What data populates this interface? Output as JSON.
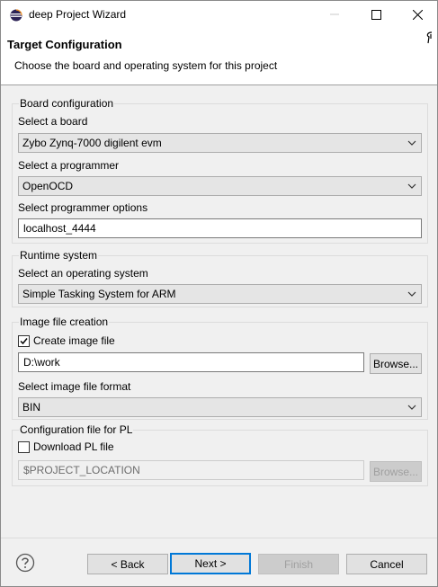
{
  "window": {
    "title": "deep Project Wizard"
  },
  "banner": {
    "title": "Target Configuration",
    "description": "Choose the board and operating system for this project"
  },
  "board_group": {
    "title": "Board configuration",
    "board_label": "Select a board",
    "board_value": "Zybo Zynq-7000 digilent evm",
    "programmer_label": "Select a programmer",
    "programmer_value": "OpenOCD",
    "options_label": "Select programmer options",
    "options_value": "localhost_4444"
  },
  "runtime_group": {
    "title": "Runtime system",
    "os_label": "Select an operating system",
    "os_value": "Simple Tasking System for ARM"
  },
  "image_group": {
    "title": "Image file creation",
    "create_label": "Create image file",
    "create_checked": true,
    "path_value": "D:\\work",
    "browse_label": "Browse...",
    "format_label": "Select image file format",
    "format_value": "BIN"
  },
  "pl_group": {
    "title": "Configuration file for PL",
    "download_label": "Download PL file",
    "download_checked": false,
    "path_value": "$PROJECT_LOCATION",
    "browse_label": "Browse..."
  },
  "footer": {
    "back_label": "< Back",
    "next_label": "Next >",
    "finish_label": "Finish",
    "cancel_label": "Cancel"
  },
  "icons": {
    "app": "eclipse-icon",
    "help": "help-icon"
  },
  "colors": {
    "accent": "#0078d7",
    "app_icon": "#2c2255"
  }
}
